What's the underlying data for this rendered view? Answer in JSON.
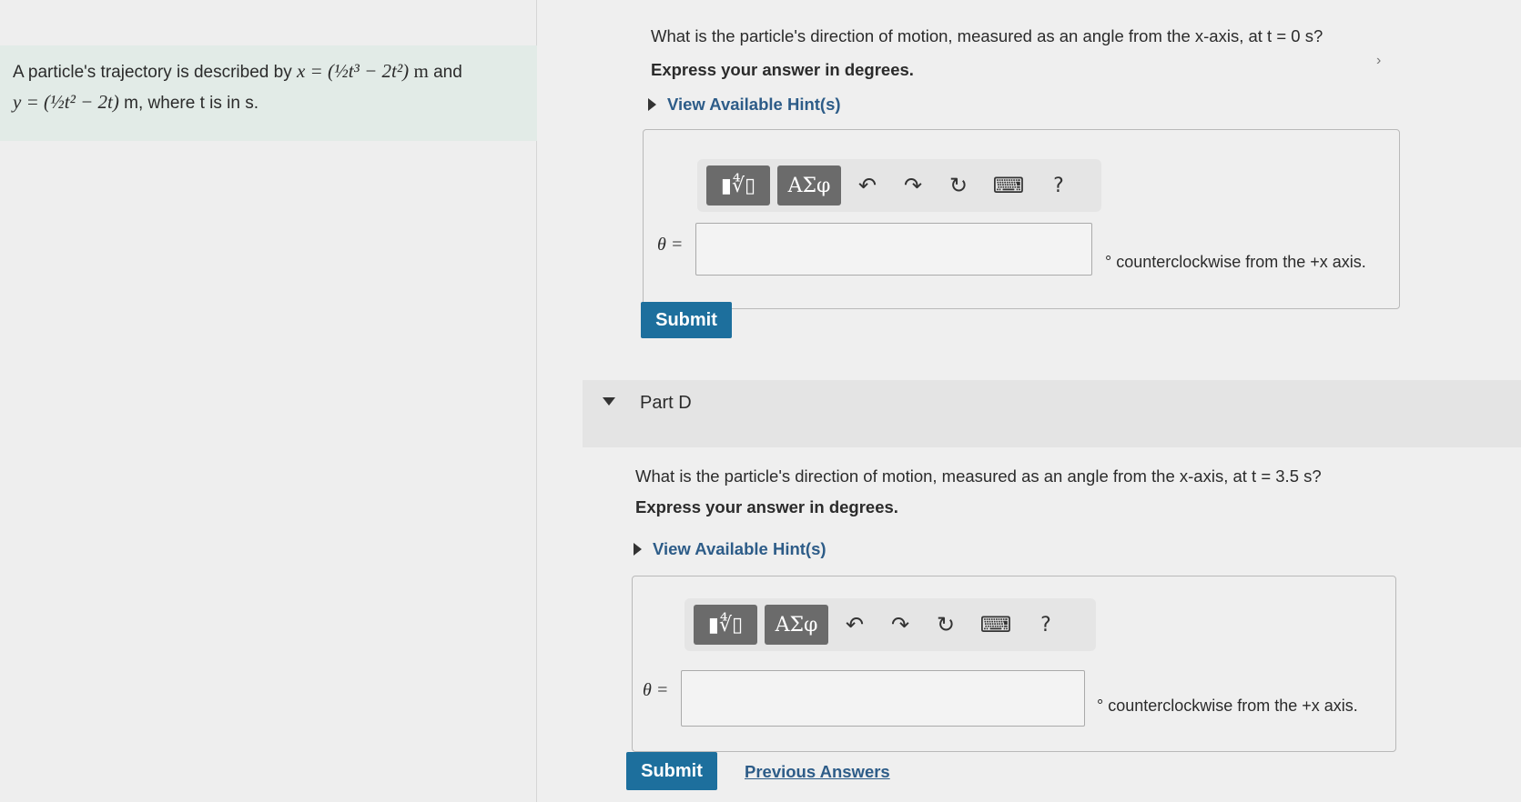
{
  "problem": {
    "lead": "A particle's trajectory is described by",
    "x_eq": "x = (½t³ − 2t²)",
    "unit_m": "m",
    "and": "and",
    "y_eq": "y = (½t² − 2t)",
    "tail": "m, where t is in s."
  },
  "part_c": {
    "question": "What is the particle's direction of motion, measured as an angle from the x-axis, at t = 0 s?",
    "instruction": "Express your answer in degrees.",
    "hint_label": "View Available Hint(s)",
    "answer_label": "θ =",
    "answer_value": "",
    "unit_text": "° counterclockwise from the +x axis.",
    "submit_label": "Submit"
  },
  "part_d": {
    "title": "Part D",
    "question": "What is the particle's direction of motion, measured as an angle from the x-axis, at t = 3.5 s?",
    "instruction": "Express your answer in degrees.",
    "hint_label": "View Available Hint(s)",
    "answer_label": "θ =",
    "answer_value": "",
    "unit_text": "° counterclockwise from the +x axis.",
    "submit_label": "Submit",
    "previous_answers_label": "Previous Answers"
  },
  "toolbar": {
    "template_label": "▮∜▯",
    "symbols_label": "ΑΣφ",
    "undo_glyph": "↶",
    "redo_glyph": "↷",
    "reset_glyph": "↻",
    "keyboard_glyph": "⌨",
    "help_glyph": "?"
  },
  "nav": {
    "next_glyph": "›"
  },
  "colors": {
    "accent": "#1d6f9d",
    "link": "#2d5c88",
    "problem_bg": "#e2ebe7"
  },
  "icons": [
    "templates-icon",
    "symbols-icon",
    "undo-icon",
    "redo-icon",
    "reset-icon",
    "keyboard-icon",
    "help-icon",
    "caret-right-icon",
    "caret-down-icon",
    "chevron-right-icon"
  ]
}
